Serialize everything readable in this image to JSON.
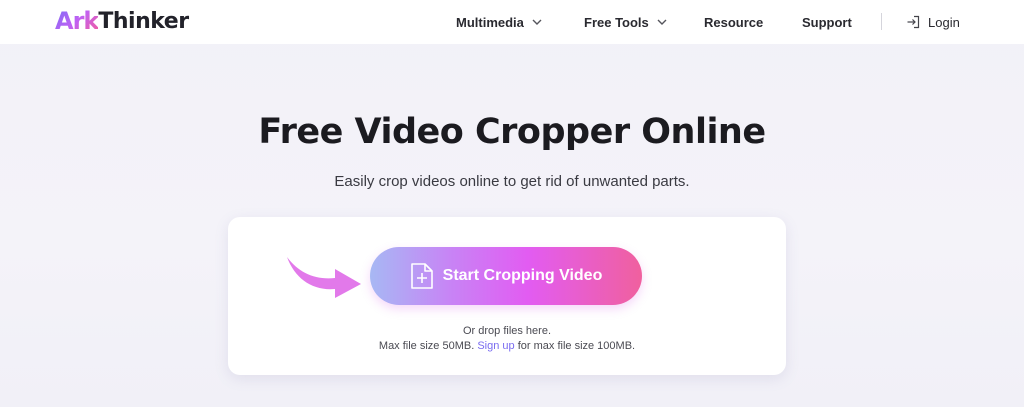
{
  "brand": {
    "mark": "Ark",
    "name": "Thinker"
  },
  "nav": {
    "items": [
      {
        "label": "Multimedia",
        "has_dropdown": true
      },
      {
        "label": "Free Tools",
        "has_dropdown": true
      },
      {
        "label": "Resource",
        "has_dropdown": false
      },
      {
        "label": "Support",
        "has_dropdown": false
      }
    ],
    "login_label": "Login"
  },
  "hero": {
    "title": "Free Video Cropper Online",
    "subtitle": "Easily crop videos online to get rid of unwanted parts."
  },
  "upload": {
    "button_label": "Start Cropping Video",
    "drop_hint": "Or drop files here.",
    "size_prefix": "Max file size 50MB.",
    "signup_link": "Sign up",
    "size_suffix": "for max file size 100MB."
  },
  "icons": {
    "login": "login-icon",
    "add_file": "add-file-icon",
    "arrow": "arrow-pointer-icon",
    "chevron": "chevron-down-icon"
  },
  "colors": {
    "accent": "#7a6cf0",
    "button_gradient_start": "#a7b8f4",
    "button_gradient_mid": "#e25cf2",
    "button_gradient_end": "#f0609e",
    "arrow": "#e279ea"
  }
}
